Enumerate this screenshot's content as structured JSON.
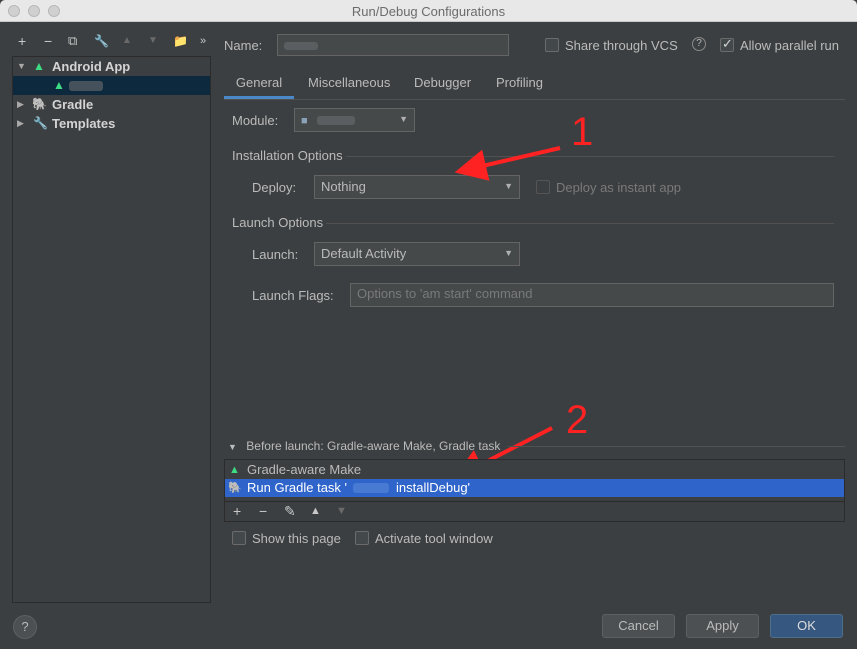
{
  "window": {
    "title": "Run/Debug Configurations"
  },
  "toolbar": {
    "add": "+",
    "remove": "−",
    "copy": "⧉",
    "edit": "🔧",
    "up": "▲",
    "down": "▼",
    "folder": "📁",
    "more": "»"
  },
  "tree": {
    "items": [
      {
        "label": "Android App",
        "icon": "android-icon",
        "expanded": true
      },
      {
        "label": "",
        "icon": "android-icon",
        "selected": true
      },
      {
        "label": "Gradle",
        "icon": "gradle-icon"
      },
      {
        "label": "Templates",
        "icon": "wrench-icon"
      }
    ]
  },
  "header": {
    "name_label": "Name:",
    "name_value": "",
    "share_vcs_label": "Share through VCS",
    "share_vcs_checked": false,
    "help_glyph": "?",
    "allow_parallel_label": "Allow parallel run",
    "allow_parallel_checked": true
  },
  "tabs": [
    {
      "label": "General",
      "active": true
    },
    {
      "label": "Miscellaneous"
    },
    {
      "label": "Debugger"
    },
    {
      "label": "Profiling"
    }
  ],
  "general": {
    "module_label": "Module:",
    "module_value": "",
    "installation_title": "Installation Options",
    "deploy_label": "Deploy:",
    "deploy_value": "Nothing",
    "instant_app_label": "Deploy as instant app",
    "launch_title": "Launch Options",
    "launch_label": "Launch:",
    "launch_value": "Default Activity",
    "launch_flags_label": "Launch Flags:",
    "launch_flags_placeholder": "Options to 'am start' command"
  },
  "before_launch": {
    "header": "Before launch: Gradle-aware Make, Gradle task",
    "items": [
      {
        "label": "Gradle-aware Make"
      },
      {
        "label": "Run Gradle task '",
        "suffix": "installDebug'",
        "selected": true
      }
    ],
    "tools": {
      "add": "+",
      "remove": "−",
      "edit": "✎",
      "up": "▲",
      "down": "▼"
    },
    "show_page_label": "Show this page",
    "activate_window_label": "Activate tool window"
  },
  "annotations": {
    "first": "1",
    "second": "2"
  },
  "buttons": {
    "help": "?",
    "cancel": "Cancel",
    "apply": "Apply",
    "ok": "OK"
  },
  "colors": {
    "accent": "#4a88c7",
    "selection": "#2f65ca",
    "annotation": "#ff2222",
    "android": "#3ddc84"
  }
}
